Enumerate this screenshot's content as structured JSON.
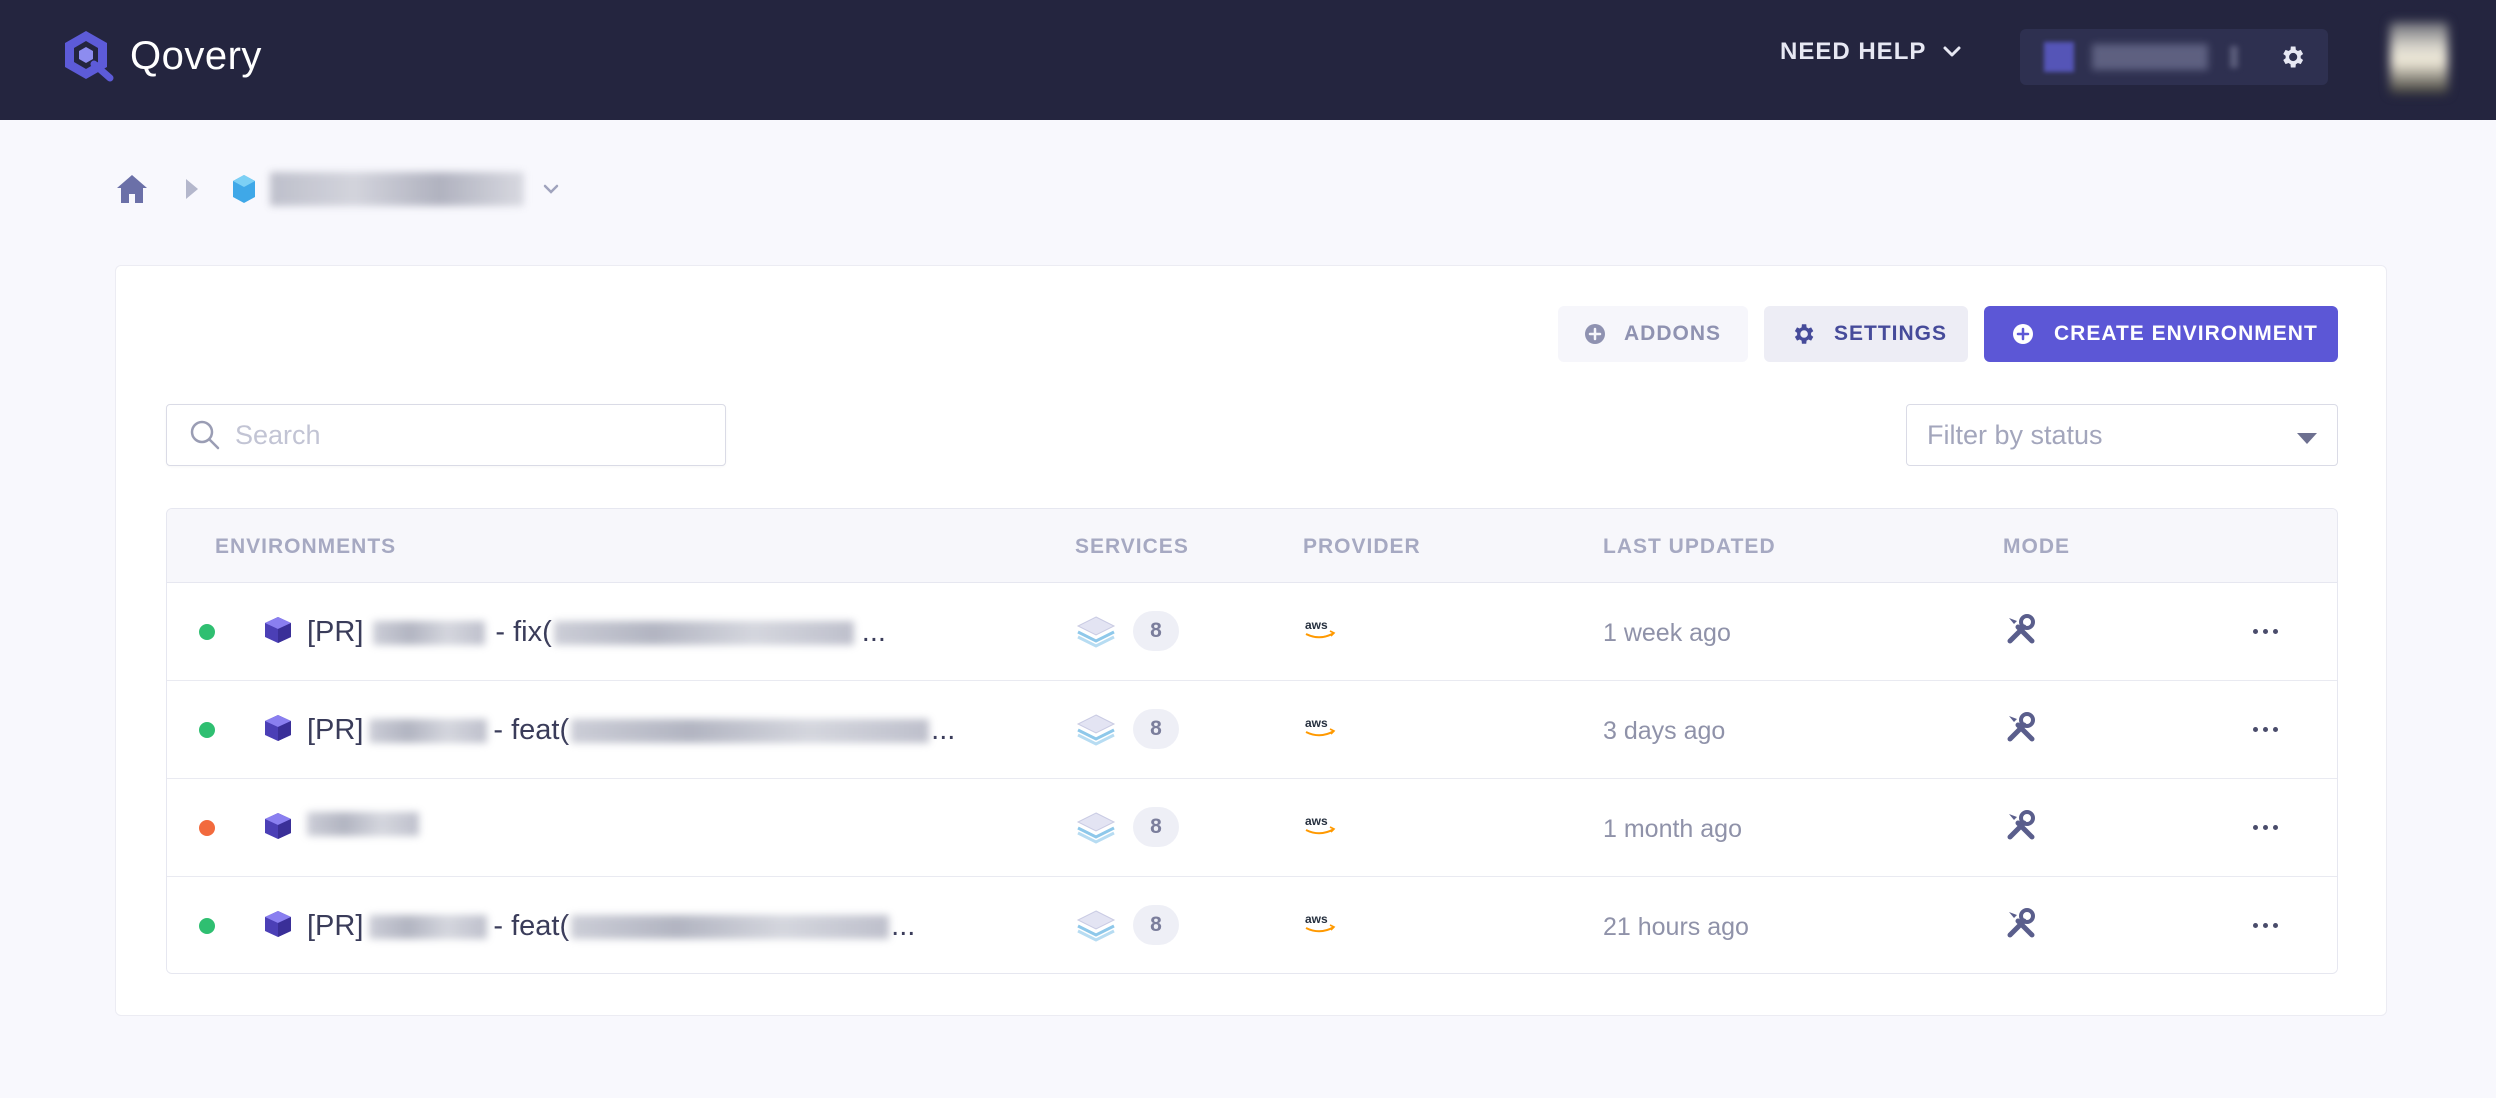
{
  "header": {
    "logo_text": "Qovery",
    "need_help": "NEED HELP",
    "colors": {
      "background": "#24253f",
      "accent": "#5c57d6"
    }
  },
  "breadcrumb": {
    "home_icon": "home-icon",
    "project_icon": "hexagon-icon"
  },
  "actions": {
    "addons": "ADDONS",
    "settings": "SETTINGS",
    "create": "CREATE ENVIRONMENT"
  },
  "search": {
    "placeholder": "Search"
  },
  "filter": {
    "placeholder": "Filter by status"
  },
  "table": {
    "headers": {
      "environments": "ENVIRONMENTS",
      "services": "SERVICES",
      "provider": "PROVIDER",
      "last_updated": "LAST UPDATED",
      "mode": "MODE"
    },
    "rows": [
      {
        "prefix": "[PR]",
        "connector": "- fix(",
        "suffix": "...",
        "status_color": "#2fbf71",
        "services": "8",
        "provider": "aws",
        "updated": "1 week ago"
      },
      {
        "prefix": "[PR]",
        "connector": "- feat(",
        "suffix": "...",
        "status_color": "#2fbf71",
        "services": "8",
        "provider": "aws",
        "updated": "3 days ago"
      },
      {
        "prefix": "",
        "connector": "",
        "suffix": "",
        "status_color": "#f26a3d",
        "services": "8",
        "provider": "aws",
        "updated": "1 month ago"
      },
      {
        "prefix": "[PR]",
        "connector": "- feat(",
        "suffix": "...",
        "status_color": "#2fbf71",
        "services": "8",
        "provider": "aws",
        "updated": "21 hours ago"
      }
    ]
  }
}
